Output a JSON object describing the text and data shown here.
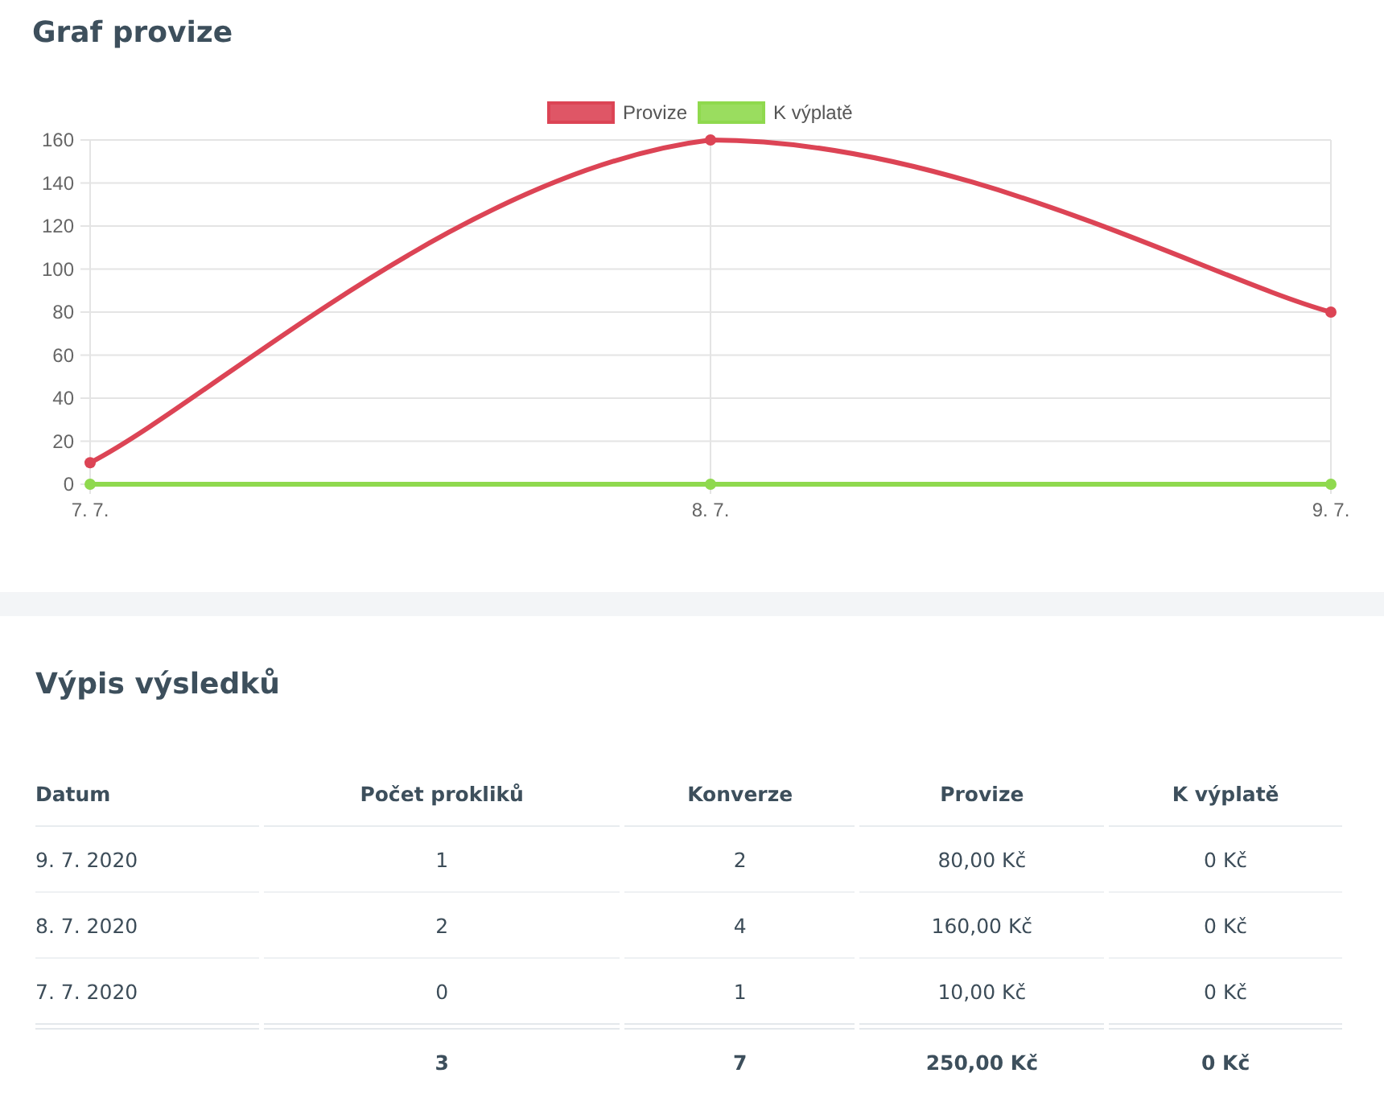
{
  "chart_section": {
    "title": "Graf provize",
    "chart_data": {
      "type": "line",
      "categories": [
        "7. 7.",
        "8. 7.",
        "9. 7."
      ],
      "ylim": [
        0,
        160
      ],
      "yticks": [
        0,
        20,
        40,
        60,
        80,
        100,
        120,
        140,
        160
      ],
      "grid": true,
      "legend": true,
      "series": [
        {
          "name": "Provize",
          "color": "#dc4455",
          "marker": "circle",
          "values": [
            10,
            160,
            80
          ]
        },
        {
          "name": "K výplatě",
          "color": "#8fd94e",
          "marker": "circle",
          "values": [
            0,
            0,
            0
          ]
        }
      ]
    }
  },
  "results": {
    "title": "Výpis výsledků",
    "columns": [
      "Datum",
      "Počet prokliků",
      "Konverze",
      "Provize",
      "K výplatě"
    ],
    "rows": [
      [
        "9. 7. 2020",
        "1",
        "2",
        "80,00 Kč",
        "0 Kč"
      ],
      [
        "8. 7. 2020",
        "2",
        "4",
        "160,00 Kč",
        "0 Kč"
      ],
      [
        "7. 7. 2020",
        "0",
        "1",
        "10,00 Kč",
        "0 Kč"
      ]
    ],
    "totals": [
      "3",
      "7",
      "250,00 Kč",
      "0 Kč"
    ]
  }
}
